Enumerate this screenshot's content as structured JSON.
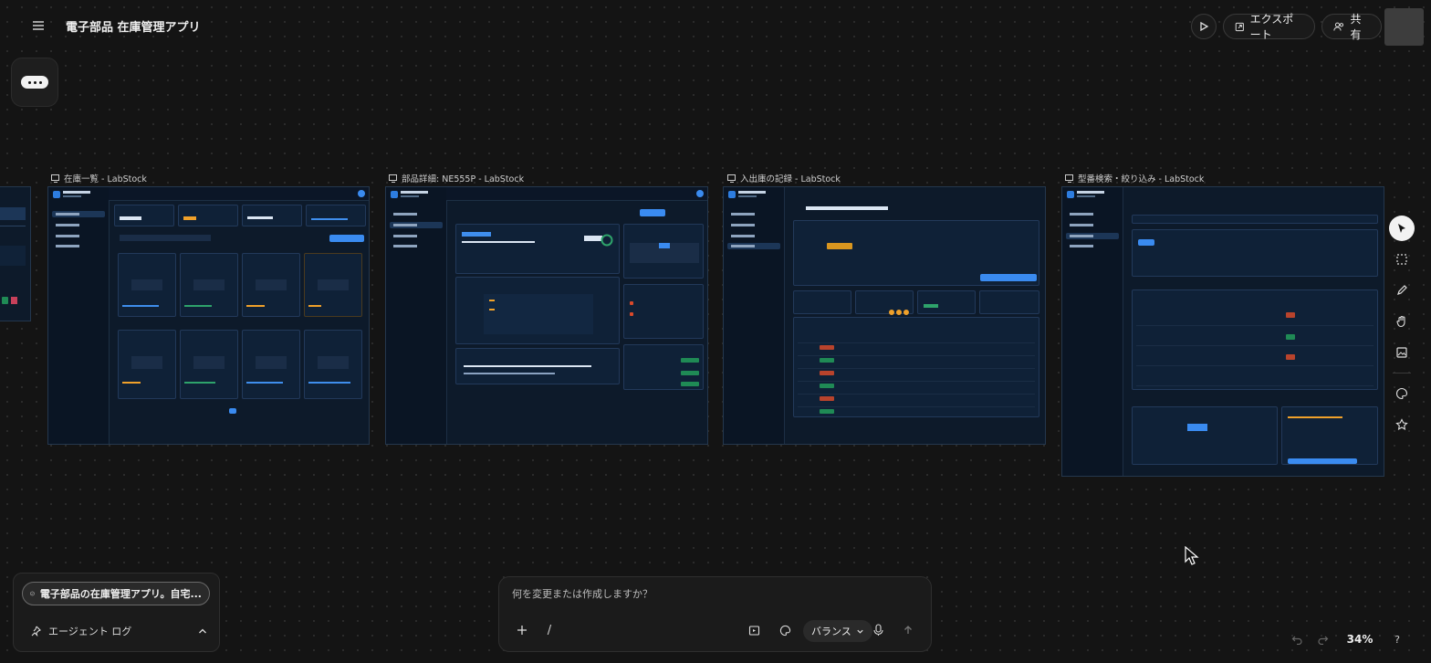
{
  "header": {
    "title": "電子部品 在庫管理アプリ",
    "export_label": "エクスポート",
    "share_label": "共有"
  },
  "frames": [
    {
      "label": "在庫一覧 - LabStock"
    },
    {
      "label": "部品詳細: NE555P - LabStock"
    },
    {
      "label": "入出庫の記録 - LabStock"
    },
    {
      "label": "型番検索・絞り込み - LabStock"
    }
  ],
  "agent": {
    "task_label": "電子部品の在庫管理アプリ。自宅...",
    "log_label": "エージェント ログ"
  },
  "prompt": {
    "placeholder": "何を変更または作成しますか？",
    "slash": "/",
    "mode_label": "バランス"
  },
  "zoom": {
    "level": "34%"
  },
  "icons": [
    "menu-icon",
    "play-icon",
    "export-icon",
    "share-icon",
    "frame-icon",
    "pointer-icon",
    "select-box-icon",
    "pen-icon",
    "hand-icon",
    "image-icon",
    "palette-icon",
    "star-icon",
    "check-circle-icon",
    "pin-icon",
    "chevron-up-icon",
    "plus-icon",
    "attach-icon",
    "palette-icon",
    "chevron-down-icon",
    "mic-icon",
    "arrow-up-icon",
    "undo-icon",
    "redo-icon",
    "help-icon"
  ]
}
